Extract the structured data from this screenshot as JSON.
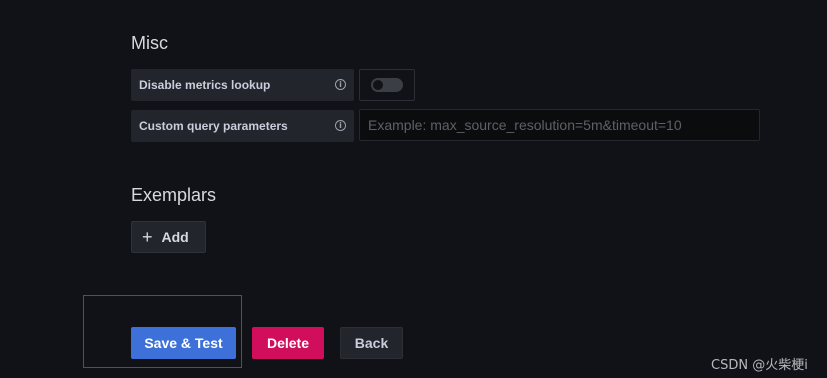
{
  "misc": {
    "title": "Misc",
    "disable_metrics_lookup": {
      "label": "Disable metrics lookup",
      "info_icon": "info-icon",
      "enabled": false
    },
    "custom_query_parameters": {
      "label": "Custom query parameters",
      "info_icon": "info-icon",
      "value": "",
      "placeholder": "Example: max_source_resolution=5m&timeout=10"
    }
  },
  "exemplars": {
    "title": "Exemplars",
    "add_icon": "plus-icon",
    "add_label": "Add"
  },
  "actions": {
    "save_test_label": "Save & Test",
    "delete_label": "Delete",
    "back_label": "Back"
  },
  "colors": {
    "background": "#111217",
    "primary": "#3d71d9",
    "danger": "#d10e5c",
    "highlight": "#e0141e"
  },
  "watermark": "CSDN @火柴梗i"
}
